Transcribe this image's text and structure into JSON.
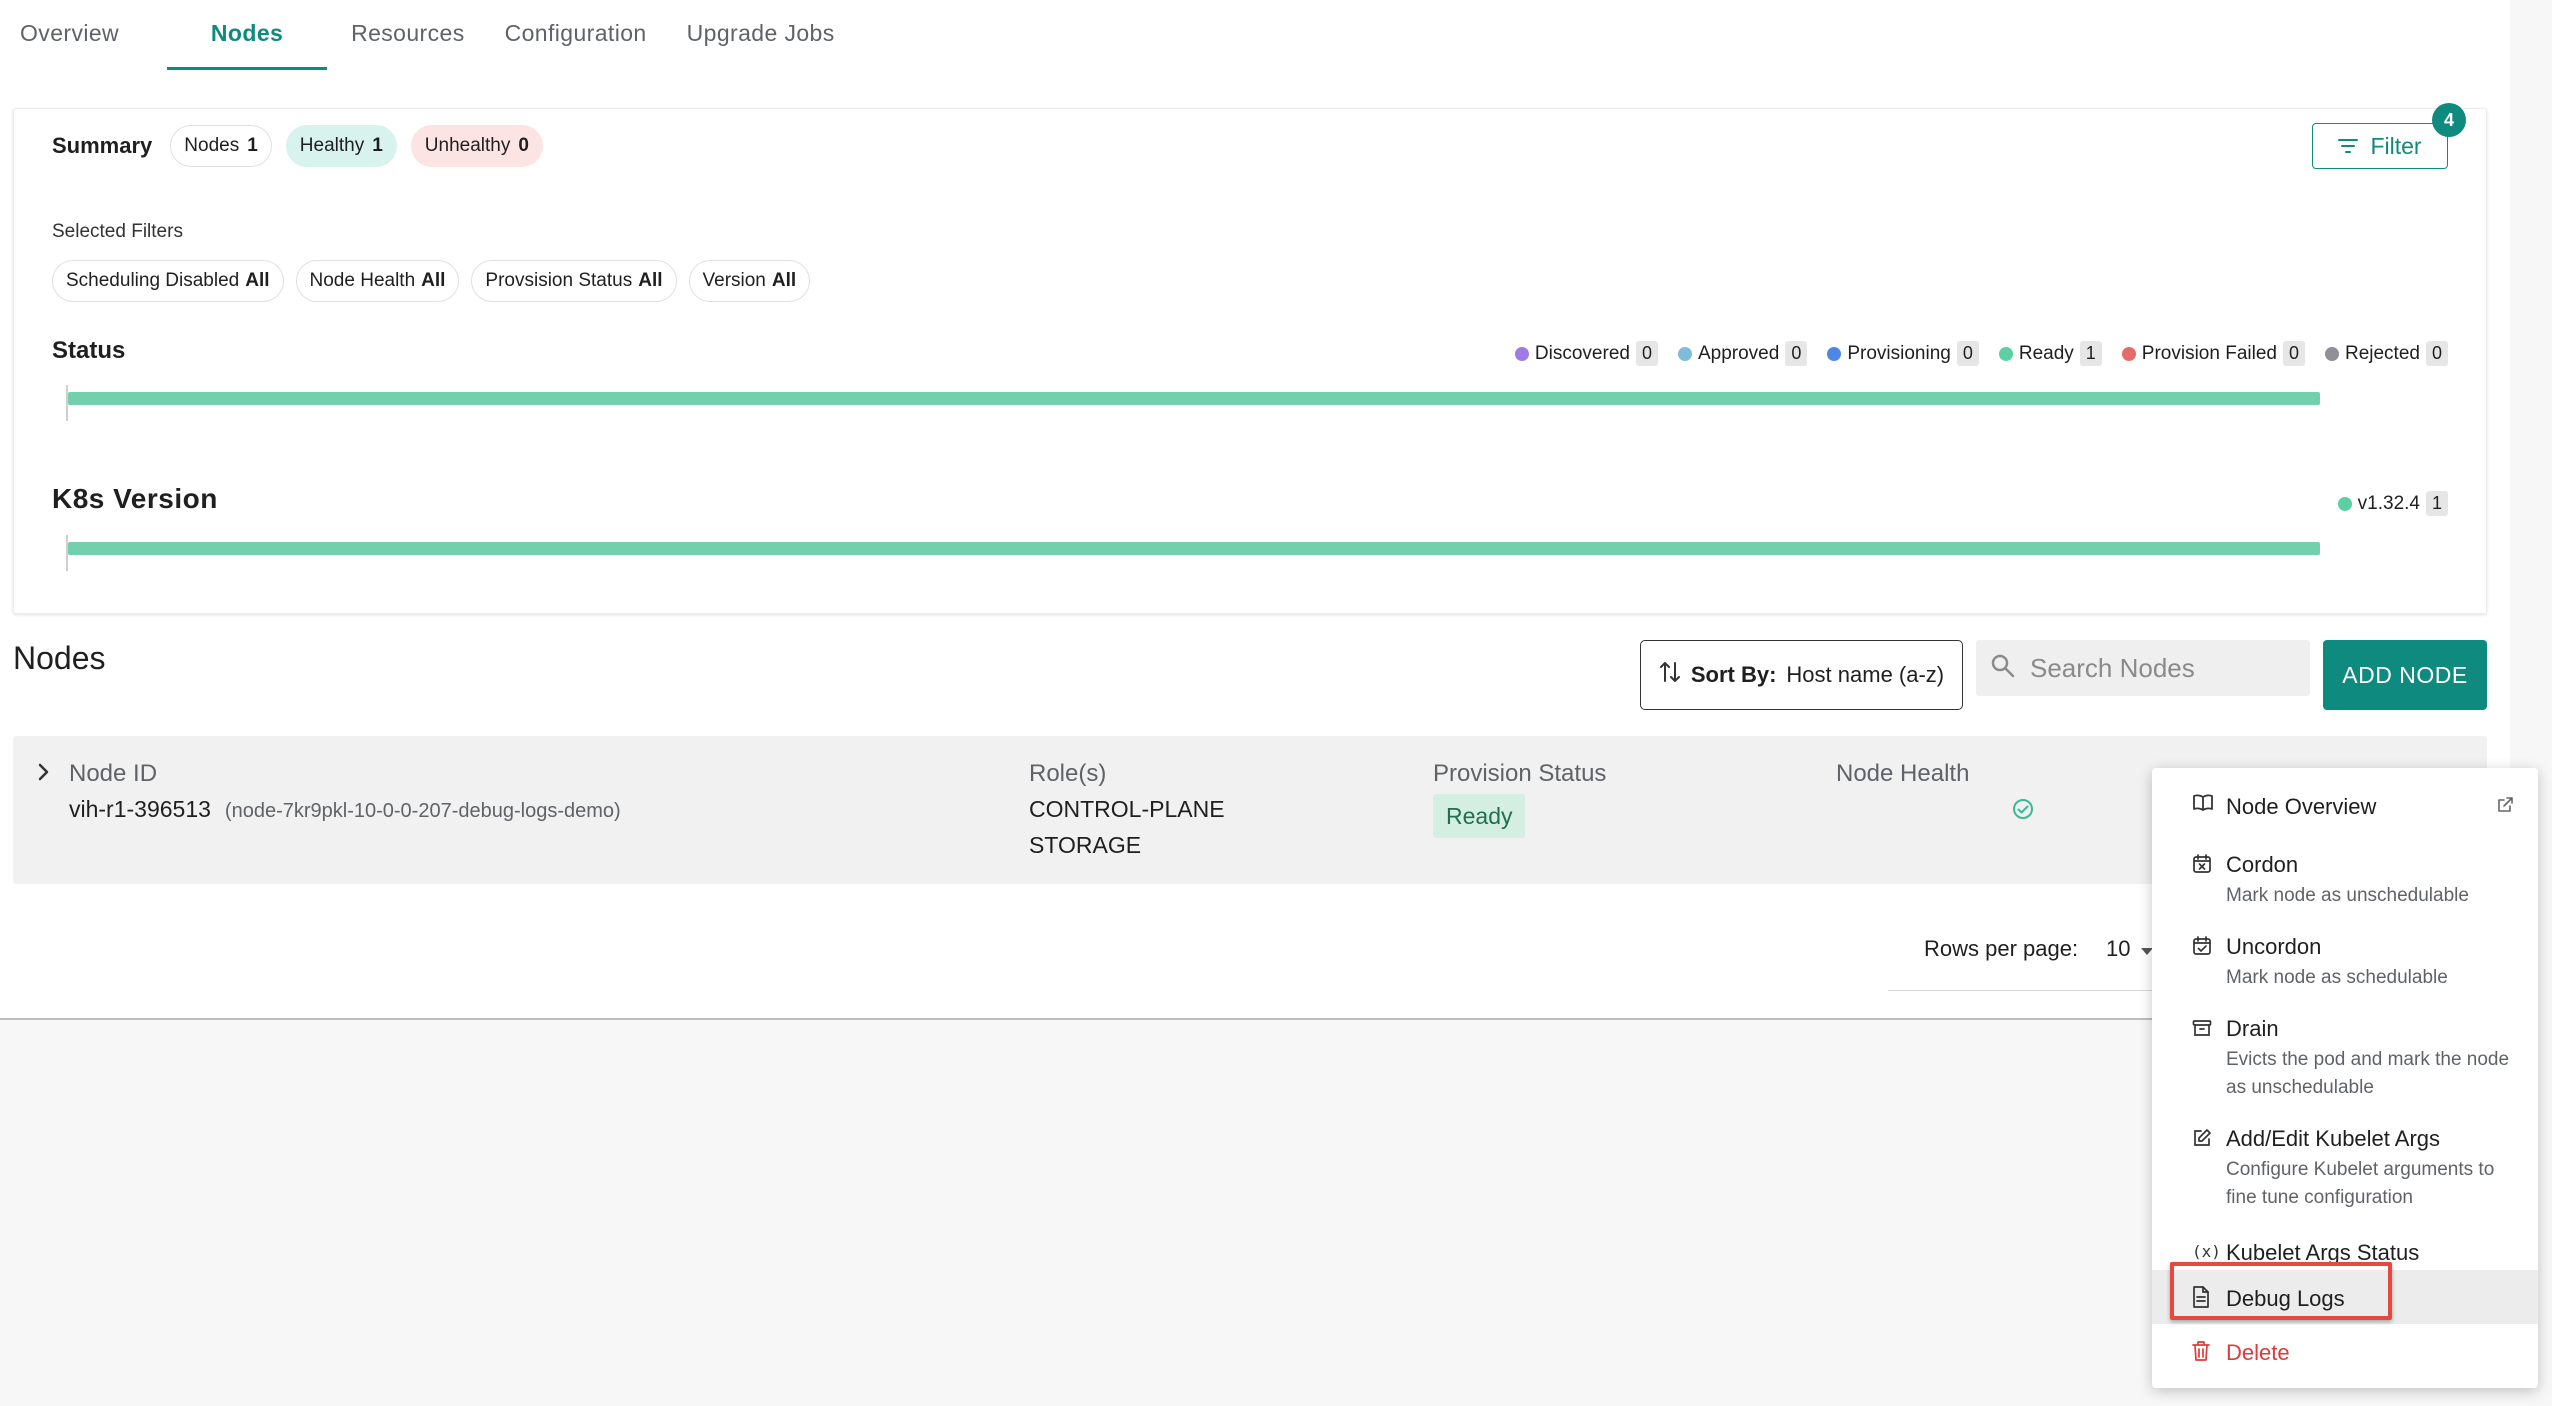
{
  "tabs": [
    {
      "label": "Overview",
      "active": false
    },
    {
      "label": "Nodes",
      "active": true
    },
    {
      "label": "Resources",
      "active": false
    },
    {
      "label": "Configuration",
      "active": false
    },
    {
      "label": "Upgrade Jobs",
      "active": false
    }
  ],
  "summary": {
    "title": "Summary",
    "nodes_label": "Nodes",
    "nodes_count": "1",
    "healthy_label": "Healthy",
    "healthy_count": "1",
    "unhealthy_label": "Unhealthy",
    "unhealthy_count": "0",
    "filter_label": "Filter",
    "filter_badge": "4"
  },
  "selected_filters": {
    "label": "Selected Filters",
    "chips": [
      {
        "name": "Scheduling Disabled",
        "value": "All"
      },
      {
        "name": "Node Health",
        "value": "All"
      },
      {
        "name": "Provsision Status",
        "value": "All"
      },
      {
        "name": "Version",
        "value": "All"
      }
    ]
  },
  "status": {
    "title": "Status",
    "legend": [
      {
        "label": "Discovered",
        "count": "0",
        "color": "#a07be8"
      },
      {
        "label": "Approved",
        "count": "0",
        "color": "#7fbcd9"
      },
      {
        "label": "Provisioning",
        "count": "0",
        "color": "#4f86e8"
      },
      {
        "label": "Ready",
        "count": "1",
        "color": "#5ccfa3"
      },
      {
        "label": "Provision Failed",
        "count": "0",
        "color": "#e56b6b"
      },
      {
        "label": "Rejected",
        "count": "0",
        "color": "#8f8f98"
      }
    ]
  },
  "k8s": {
    "title": "K8s Version",
    "legend": [
      {
        "label": "v1.32.4",
        "count": "1",
        "color": "#5ccfa3"
      }
    ]
  },
  "nodes_section": {
    "title": "Nodes",
    "sort_prefix": "Sort By:",
    "sort_value": "Host name (a-z)",
    "search_placeholder": "Search Nodes",
    "add_button": "ADD NODE"
  },
  "node_row": {
    "node_id_header": "Node ID",
    "node_id": "vih-r1-396513",
    "node_sub": "(node-7kr9pkl-10-0-0-207-debug-logs-demo)",
    "roles_header": "Role(s)",
    "role_1": "CONTROL-PLANE",
    "role_2": "STORAGE",
    "provision_header": "Provision Status",
    "provision_value": "Ready",
    "health_header": "Node Health"
  },
  "pagination": {
    "rows_label": "Rows per page:",
    "rows_value": "10"
  },
  "menu": {
    "node_overview": "Node Overview",
    "cordon": "Cordon",
    "cordon_sub": "Mark node as unschedulable",
    "uncordon": "Uncordon",
    "uncordon_sub": "Mark node as schedulable",
    "drain": "Drain",
    "drain_sub": "Evicts the pod and mark the node as unschedulable",
    "kubelet_args": "Add/Edit Kubelet Args",
    "kubelet_args_sub": "Configure Kubelet arguments to fine tune configuration",
    "kubelet_status": "Kubelet Args Status",
    "debug_logs": "Debug Logs",
    "delete": "Delete"
  },
  "colors": {
    "accent": "#0f8a7e",
    "bar": "#72d1ac",
    "danger": "#e03a3a",
    "highlight_border": "#e5493f"
  }
}
